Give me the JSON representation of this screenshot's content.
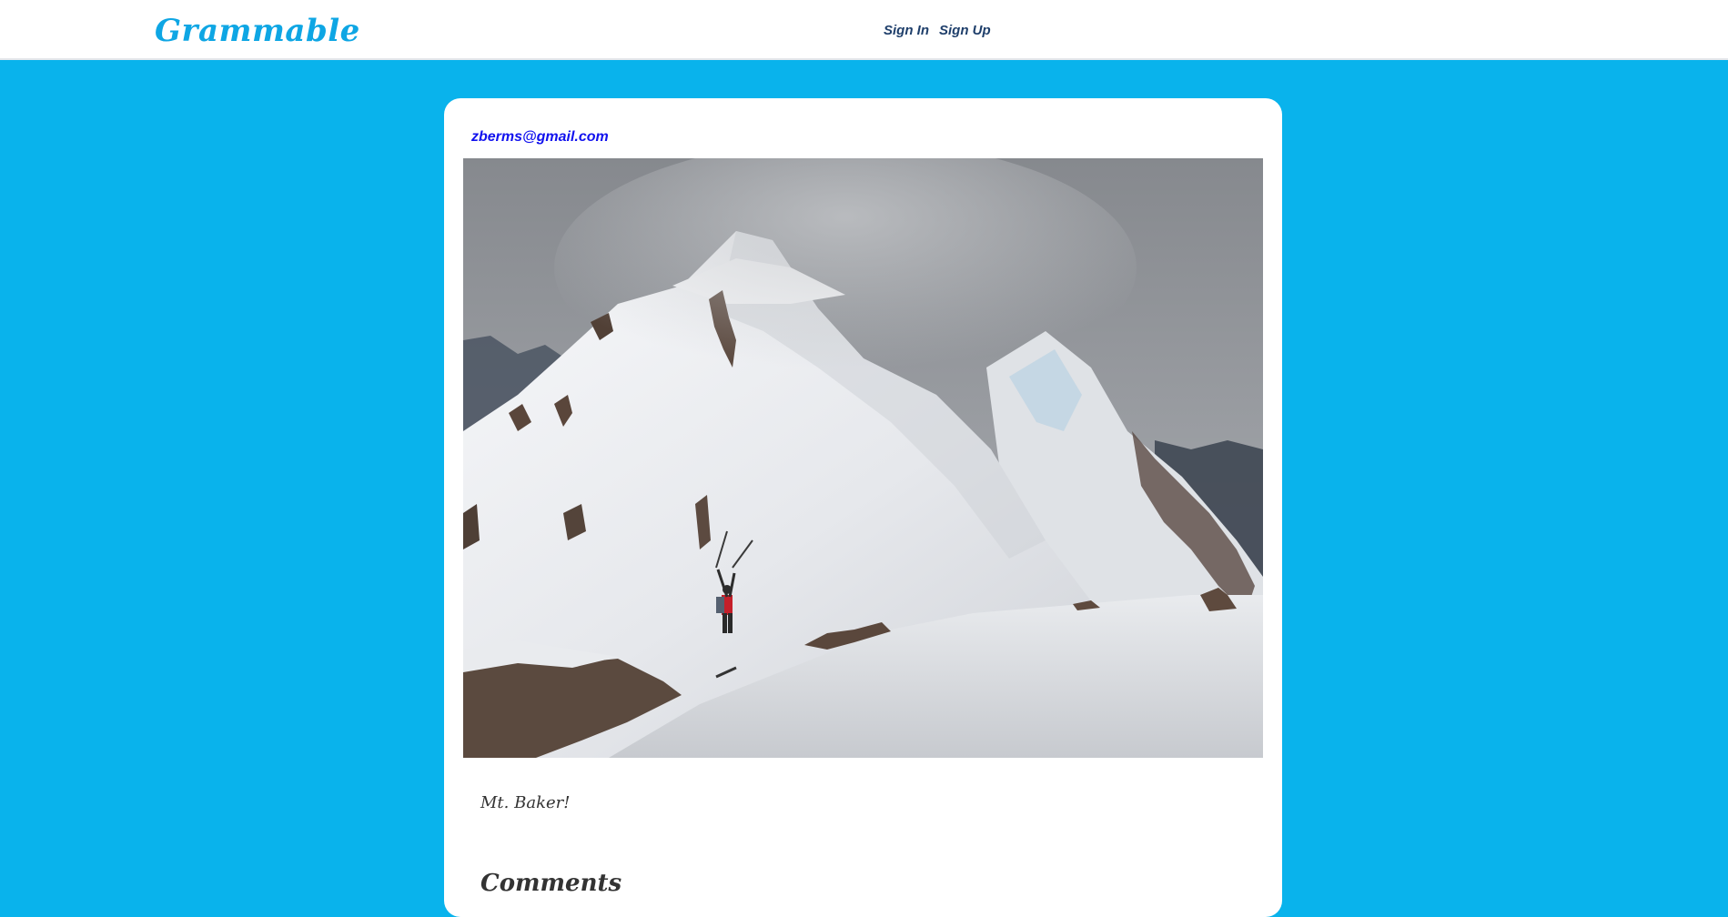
{
  "navbar": {
    "brand": "Grammable",
    "links": [
      {
        "label": "Sign In"
      },
      {
        "label": "Sign Up"
      }
    ]
  },
  "post": {
    "author_email": "zberms@gmail.com",
    "image_alt": "Skier with raised poles on snowy Mt. Baker ridge under cloudy sky",
    "caption": "Mt. Baker!",
    "comments_heading": "Comments"
  },
  "colors": {
    "page_background": "#09b3ec",
    "brand": "#0ea6e4",
    "nav_link": "#1f3f6b",
    "author_link": "#1212ee",
    "card": "#ffffff"
  }
}
